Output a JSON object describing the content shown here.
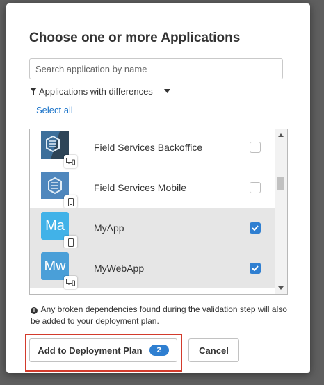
{
  "dialog": {
    "title": "Choose one or more Applications",
    "search_placeholder": "Search application by name",
    "filter_label": "Applications with differences",
    "select_all_label": "Select all",
    "info_text": "Any broken dependencies found during the validation step will also be added to your deployment plan.",
    "info_icon": "info-icon",
    "accent_color": "#2f7fd1",
    "highlight_color": "#d33b2c"
  },
  "applications": [
    {
      "name": "Field Services Backoffice",
      "icon_text": "",
      "icon": "field-services-logo",
      "platform": "desktop-mobile-icon",
      "checked": false,
      "selected": false
    },
    {
      "name": "Field Services Mobile",
      "icon_text": "",
      "icon": "field-services-logo",
      "platform": "mobile-icon",
      "checked": false,
      "selected": false
    },
    {
      "name": "MyApp",
      "icon_text": "Ma",
      "icon": "letter-tile",
      "platform": "mobile-icon",
      "checked": true,
      "selected": true
    },
    {
      "name": "MyWebApp",
      "icon_text": "Mw",
      "icon": "letter-tile",
      "platform": "desktop-mobile-icon",
      "checked": true,
      "selected": true
    }
  ],
  "buttons": {
    "add_label": "Add to Deployment Plan",
    "add_count": "2",
    "cancel_label": "Cancel"
  }
}
